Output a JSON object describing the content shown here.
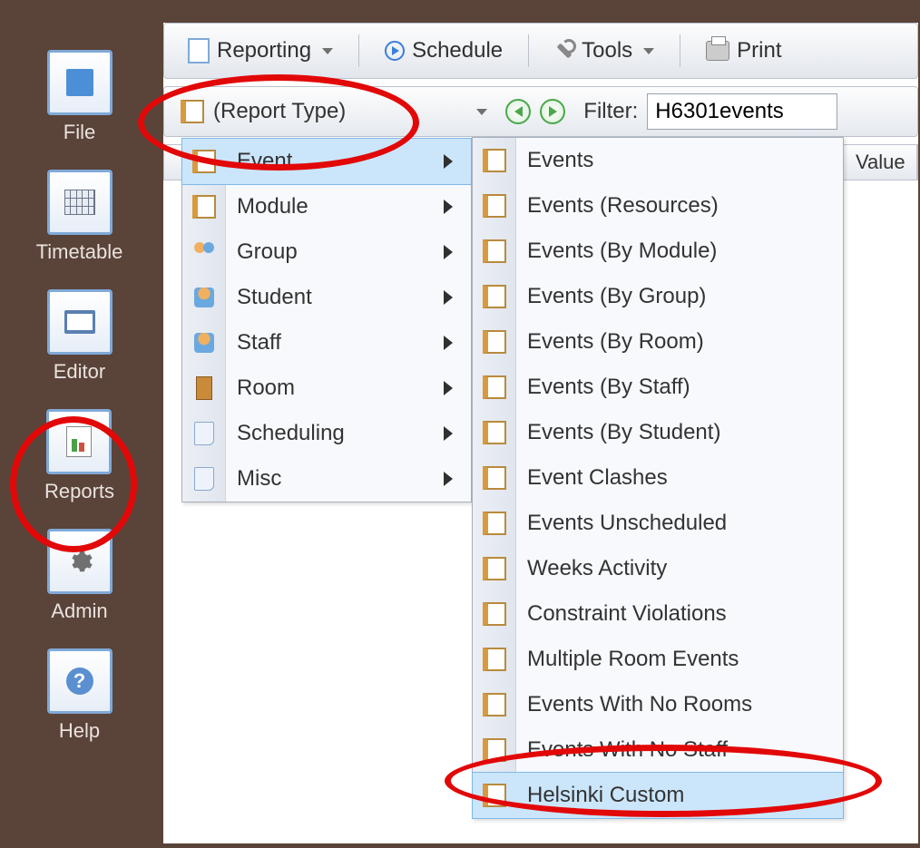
{
  "sidebar": {
    "items": [
      {
        "label": "File"
      },
      {
        "label": "Timetable"
      },
      {
        "label": "Editor"
      },
      {
        "label": "Reports"
      },
      {
        "label": "Admin"
      },
      {
        "label": "Help"
      }
    ]
  },
  "toolbar": {
    "reporting": "Reporting",
    "schedule": "Schedule",
    "tools": "Tools",
    "print": "Print"
  },
  "report_bar": {
    "type_label": "(Report Type)",
    "filter_label": "Filter:",
    "filter_value": "H6301events"
  },
  "columns": {
    "value": "Value"
  },
  "menu_report_type": {
    "items": [
      {
        "label": "Event",
        "icon": "report",
        "hl": true
      },
      {
        "label": "Module",
        "icon": "module"
      },
      {
        "label": "Group",
        "icon": "group"
      },
      {
        "label": "Student",
        "icon": "person"
      },
      {
        "label": "Staff",
        "icon": "person"
      },
      {
        "label": "Room",
        "icon": "door"
      },
      {
        "label": "Scheduling",
        "icon": "scroll"
      },
      {
        "label": "Misc",
        "icon": "scroll"
      }
    ]
  },
  "menu_event": {
    "items": [
      {
        "label": "Events"
      },
      {
        "label": "Events (Resources)"
      },
      {
        "label": "Events (By Module)"
      },
      {
        "label": "Events (By Group)"
      },
      {
        "label": "Events (By Room)"
      },
      {
        "label": "Events (By Staff)"
      },
      {
        "label": "Events (By Student)"
      },
      {
        "label": "Event Clashes"
      },
      {
        "label": "Events Unscheduled"
      },
      {
        "label": "Weeks Activity"
      },
      {
        "label": "Constraint Violations"
      },
      {
        "label": "Multiple Room Events"
      },
      {
        "label": "Events With No Rooms"
      },
      {
        "label": "Events With No Staff"
      },
      {
        "label": "Helsinki Custom",
        "hl": true
      }
    ]
  }
}
